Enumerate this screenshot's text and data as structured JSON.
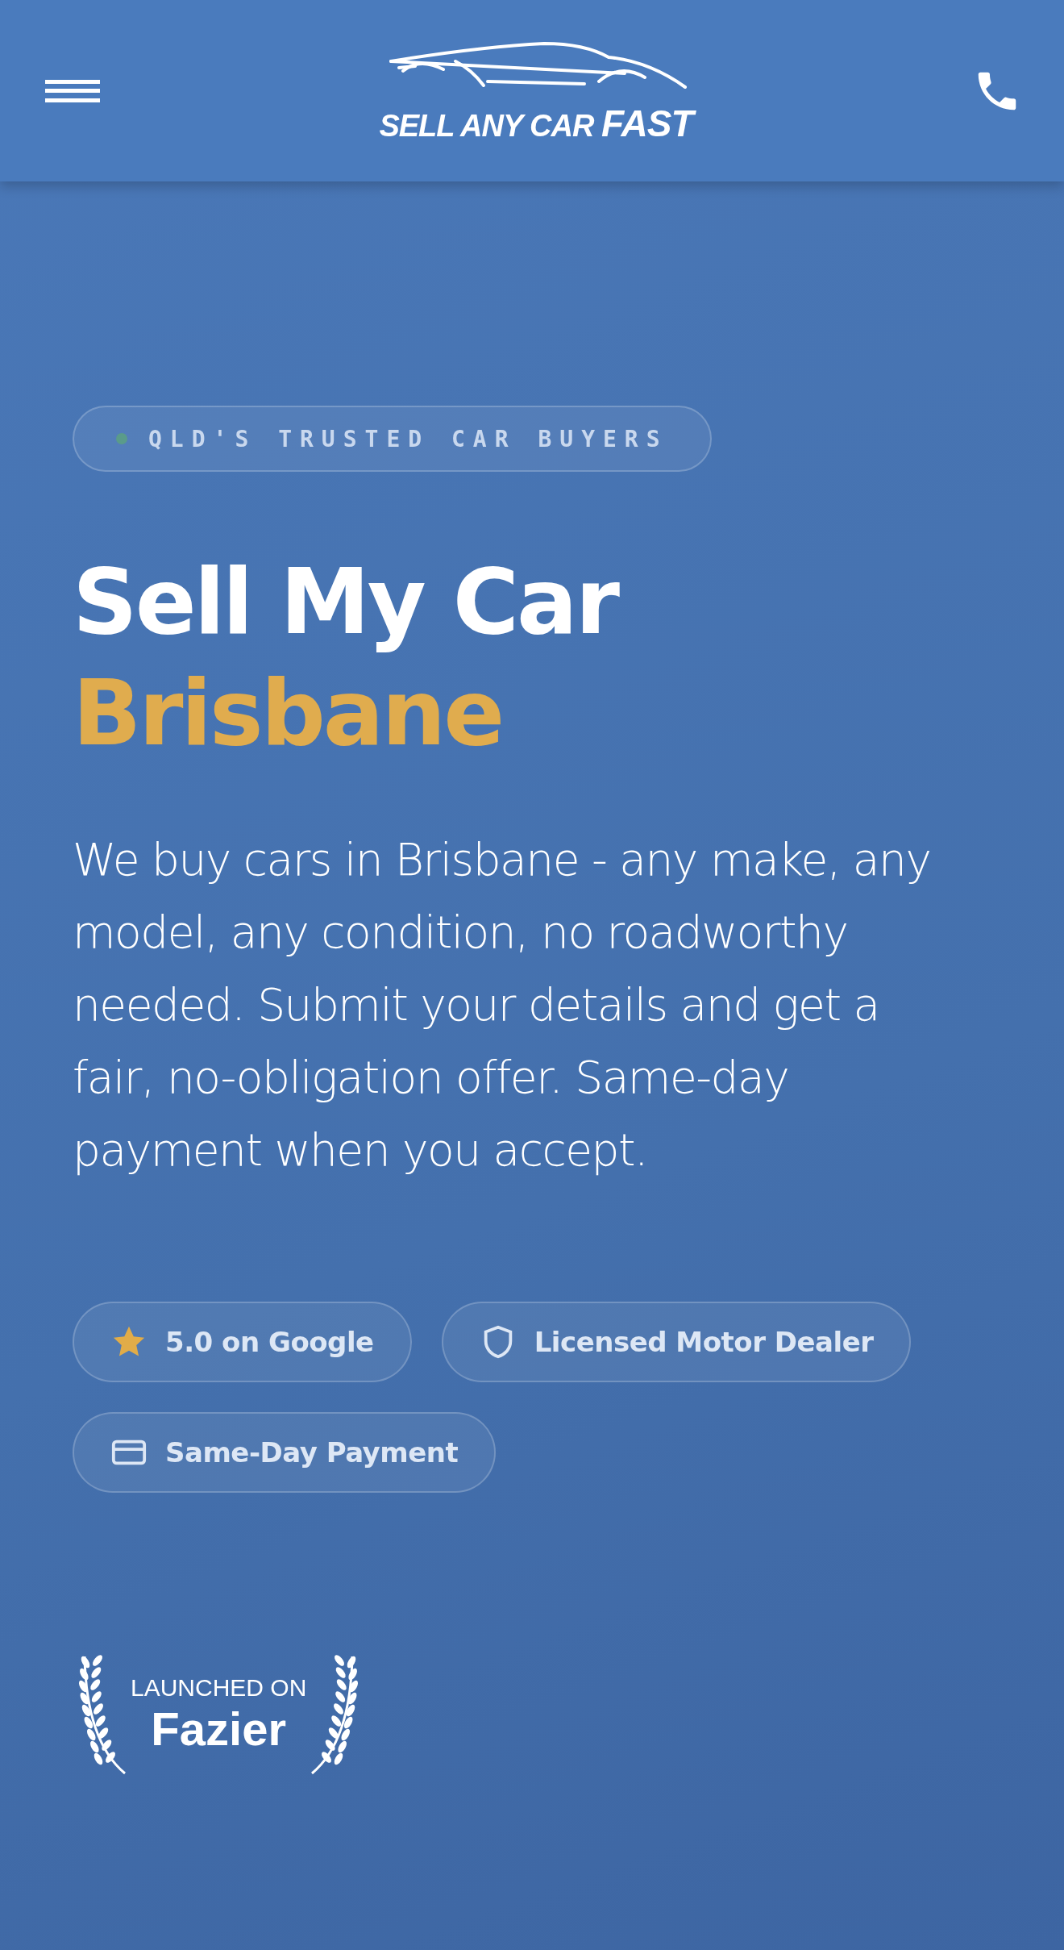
{
  "header": {
    "logo": {
      "text": "SELL ANY CAR",
      "emphasis": "FAST"
    }
  },
  "hero": {
    "eyebrow": "QLD'S TRUSTED CAR BUYERS",
    "title": "Sell My Car",
    "highlight": "Brisbane",
    "description": "We buy cars in Brisbane - any make, any model, any condition, no roadworthy needed. Submit your details and get a fair, no-obligation offer. Same-day payment when you accept.",
    "chips": [
      {
        "kind": "star",
        "label": "5.0 on Google"
      },
      {
        "kind": "shield",
        "label": "Licensed Motor Dealer"
      },
      {
        "kind": "card",
        "label": "Same-Day Payment"
      }
    ],
    "award": {
      "caption": "LAUNCHED ON",
      "name": "Fazier"
    }
  }
}
